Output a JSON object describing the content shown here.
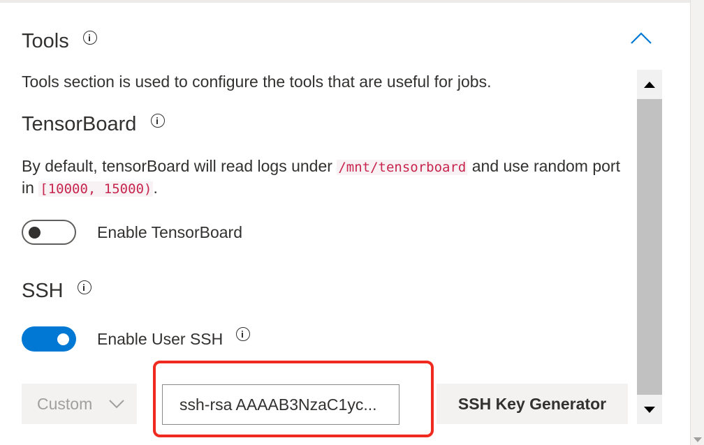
{
  "tools": {
    "title": "Tools",
    "description": "Tools section is used to configure the tools that are useful for jobs."
  },
  "tensorboard": {
    "title": "TensorBoard",
    "desc_part1": "By default, tensorBoard will read logs under ",
    "desc_path": "/mnt/tensorboard",
    "desc_part2": " and use random port in ",
    "desc_range": "[10000, 15000)",
    "desc_part3": ".",
    "toggle_label": "Enable TensorBoard",
    "enabled": false
  },
  "ssh": {
    "title": "SSH",
    "toggle_label": "Enable User SSH",
    "enabled": true,
    "key_source_option": "Custom",
    "public_key_value": "ssh-rsa AAAAB3NzaC1yc...",
    "generator_button": "SSH Key Generator"
  },
  "icons": {
    "info": "info-icon",
    "collapse": "chevron-up-icon",
    "dropdown": "chevron-down-icon"
  },
  "colors": {
    "accent": "#0078d4",
    "highlight": "#f02a1e",
    "code_text": "#c7254e"
  }
}
